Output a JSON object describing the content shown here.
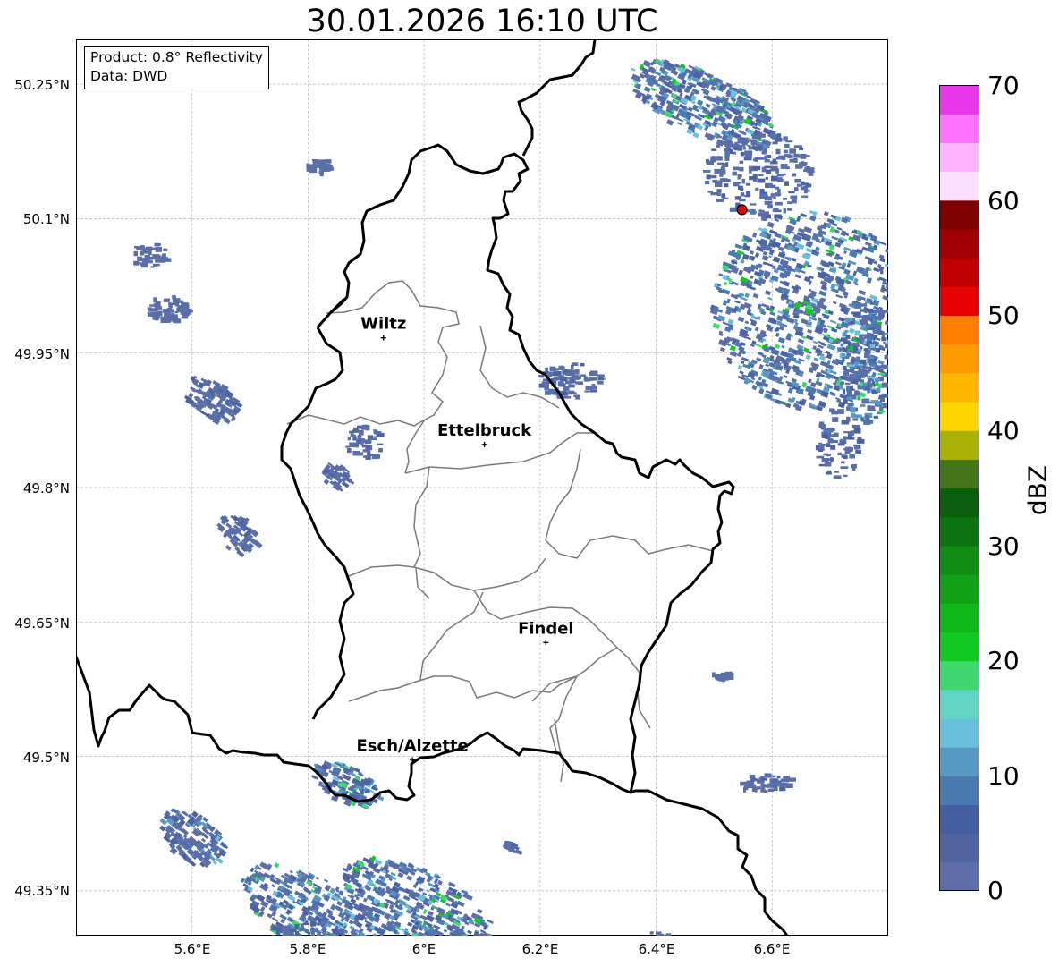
{
  "title": "30.01.2026 16:10 UTC",
  "info": {
    "product": "Product: 0.8° Reflectivity",
    "data": "Data: DWD"
  },
  "axes": {
    "y_ticks": [
      "50.25°N",
      "50.1°N",
      "49.95°N",
      "49.8°N",
      "49.65°N",
      "49.5°N",
      "49.35°N"
    ],
    "x_ticks": [
      "5.6°E",
      "5.8°E",
      "6°E",
      "6.2°E",
      "6.4°E",
      "6.6°E"
    ],
    "lon_range": [
      5.4,
      6.8
    ],
    "lat_range": [
      49.3,
      50.3
    ],
    "grid": true
  },
  "cities": [
    {
      "name": "Wiltz",
      "lon": 5.93,
      "lat": 49.967
    },
    {
      "name": "Ettelbruck",
      "lon": 6.104,
      "lat": 49.848
    },
    {
      "name": "Findel",
      "lon": 6.21,
      "lat": 49.627
    },
    {
      "name": "Esch/Alzette",
      "lon": 5.98,
      "lat": 49.496
    }
  ],
  "radar_site": {
    "lon": 6.548,
    "lat": 50.11,
    "color": "#e00000"
  },
  "colorbar": {
    "label": "dBZ",
    "ticks": [
      "70",
      "60",
      "50",
      "40",
      "30",
      "20",
      "10",
      "0"
    ],
    "min": 0,
    "max": 70,
    "colors": [
      "#5f6ea8",
      "#51649f",
      "#445f9f",
      "#4a7ab0",
      "#5899c4",
      "#69c0da",
      "#62d4c4",
      "#3fd86e",
      "#10c921",
      "#0fb81a",
      "#10a215",
      "#0f8c12",
      "#0b7310",
      "#0b5f0c",
      "#44761a",
      "#aab207",
      "#fdd600",
      "#fdb700",
      "#fe9b00",
      "#fe7e00",
      "#e60000",
      "#c00000",
      "#a00000",
      "#7f0000",
      "#fee0fe",
      "#feb4fe",
      "#fe73fe",
      "#ea36ea"
    ]
  }
}
